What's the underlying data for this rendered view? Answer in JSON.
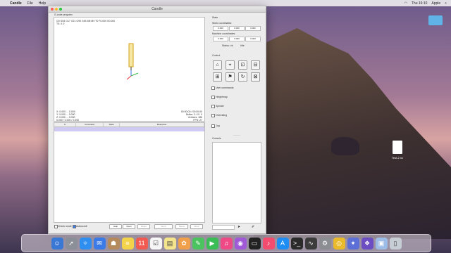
{
  "menubar": {
    "app": "Candle",
    "items": [
      "File",
      "Help"
    ],
    "clock": "Thu 16:10",
    "user": "Apple"
  },
  "window": {
    "title": "Candle"
  },
  "visualizer": {
    "header_line": "G-code program",
    "gcode_line1": "G0 G54 G17 G21 G90 G94 M5 M9 T0 F0.000 S0.000",
    "gcode_line2": "T0: X 0",
    "coords": [
      "X: 0.000 ... 0.000",
      "Y: 0.000 ... 0.000",
      "Z: 0.000 ... 0.000",
      "0.000 / 0.000 / 0.000"
    ],
    "stats": [
      "00:00:00 / 00:00:00",
      "Buffer: 0 / 0 / 0",
      "Vertices: 186",
      "FPS: 27"
    ]
  },
  "table": {
    "columns": [
      "#",
      "Command",
      "State",
      "Response"
    ]
  },
  "bottom": {
    "check_mode": "Check mode",
    "autoscroll": "Autoscroll",
    "buttons": [
      "Help",
      "Open",
      "Reset",
      "Send",
      "Pause",
      "Abort"
    ]
  },
  "side": {
    "state_header": "State",
    "work_coords_label": "Work coordinates:",
    "machine_coords_label": "Machine coordinates:",
    "work_coords": [
      "0.000",
      "0.000",
      "0.000"
    ],
    "machine_coords": [
      "0.000",
      "0.000",
      "0.000"
    ],
    "status_left": "Status: ok",
    "status_right": "Idle",
    "control_header": "Control",
    "sections": [
      "User commands",
      "Heightmap",
      "Spindle",
      "Overriding",
      "Jog"
    ],
    "console_header": "Console",
    "console_placeholder": "_____"
  },
  "desktop": {
    "file_label": "Test-2.nc"
  },
  "dock": {
    "icons": [
      "finder",
      "rocket",
      "safari",
      "mail",
      "contacts",
      "notes",
      "calendar",
      "reminders",
      "stickies",
      "photos",
      "messages",
      "facetime",
      "itunes",
      "podcasts",
      "tv",
      "music",
      "appstore",
      "terminal",
      "activity",
      "preferences",
      "chrome",
      "candle",
      "launcher",
      "preview",
      "trash"
    ],
    "colors": {
      "finder": "#3a78d6",
      "rocket": "#8a8f98",
      "safari": "#2f8ff0",
      "mail": "#3b7be8",
      "contacts": "#b58b5e",
      "notes": "#f3d34a",
      "calendar": "#f25b52",
      "reminders": "#f6f6f6",
      "stickies": "#f4e48c",
      "photos": "#f0a04a",
      "messages": "#4bc45f",
      "facetime": "#3bbd56",
      "itunes": "#f04a86",
      "podcasts": "#a05ad8",
      "tv": "#222",
      "music": "#f44c6e",
      "appstore": "#1e8ef5",
      "terminal": "#2b2b2b",
      "activity": "#3c3c3c",
      "preferences": "#8b8d93",
      "chrome": "#e9ba2a",
      "candle": "#5c6fd6",
      "launcher": "#6d4ec2",
      "preview": "#9dbde6",
      "trash": "#c7cdd4"
    },
    "glyphs": {
      "finder": "☺",
      "rocket": "➚",
      "safari": "✧",
      "mail": "✉",
      "contacts": "☗",
      "notes": "≡",
      "calendar": "11",
      "reminders": "☑",
      "stickies": "▤",
      "photos": "✿",
      "messages": "✎",
      "facetime": "▶",
      "itunes": "♫",
      "podcasts": "◉",
      "tv": "▭",
      "music": "♪",
      "appstore": "A",
      "terminal": ">_",
      "activity": "∿",
      "preferences": "⚙",
      "chrome": "◎",
      "candle": "✦",
      "launcher": "❖",
      "preview": "▣",
      "trash": "▯"
    }
  }
}
